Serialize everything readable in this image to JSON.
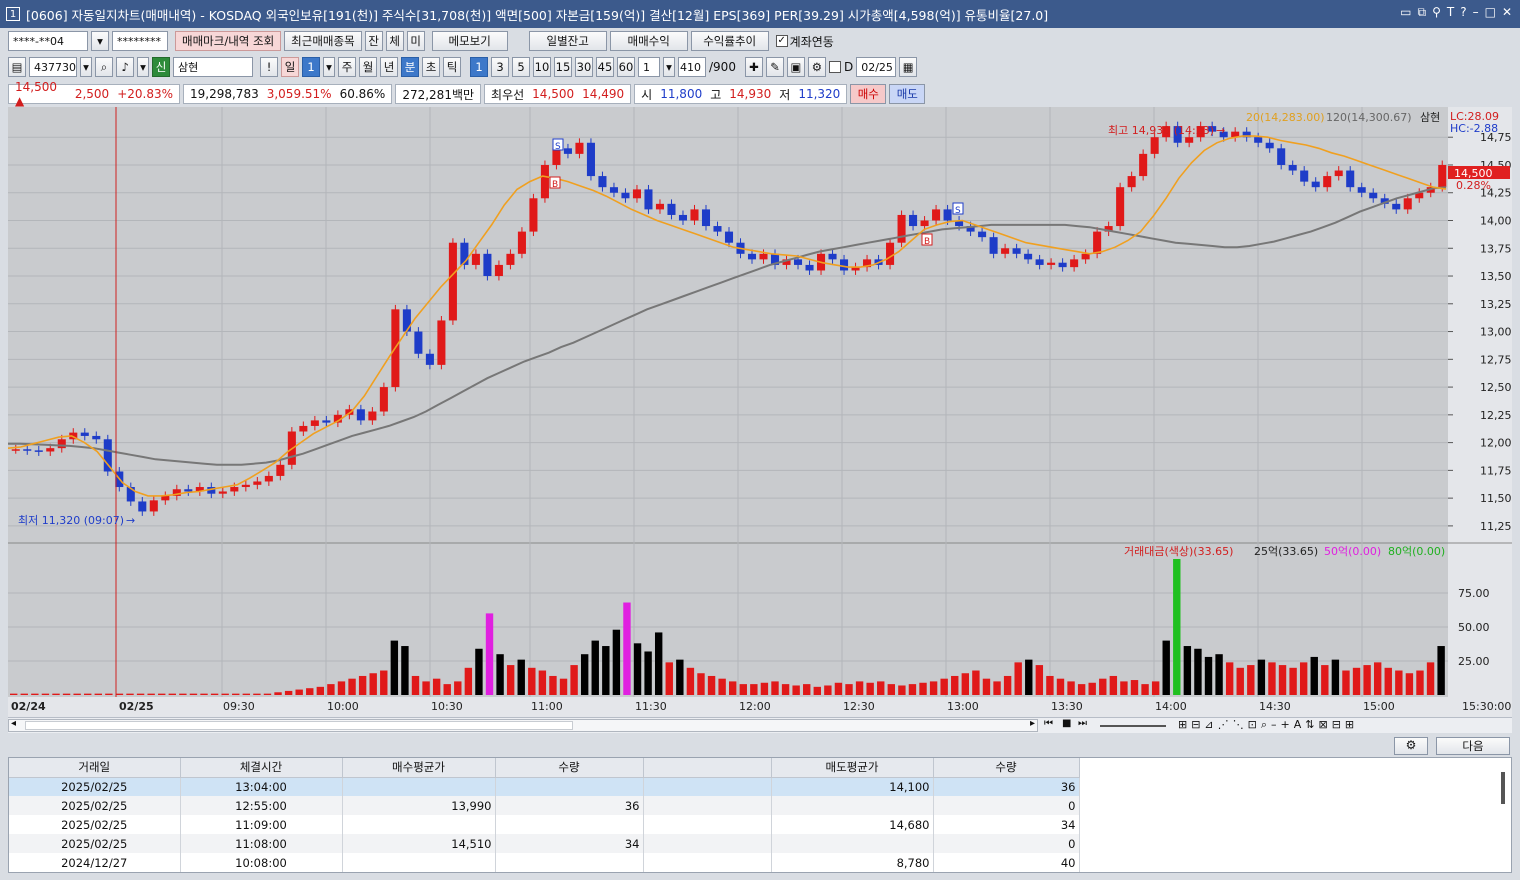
{
  "window": {
    "icon": "1",
    "title": "[0606] 자동일지차트(매매내역) - KOSDAQ 외국인보유[191(천)] 주식수[31,708(천)] 액면[500] 자본금[159(억)] 결산[12월] EPS[369] PER[39.29] 시가총액[4,598(억)] 유통비율[27.0]"
  },
  "toolbar1": {
    "account": "****-**04",
    "password": "********",
    "mark_btn": "매매마크/내역 조회",
    "recent_btn": "최근매매종목",
    "btn_jan": "잔",
    "btn_che": "체",
    "btn_mi": "미",
    "memo_btn": "메모보기",
    "daily_btn": "일별잔고",
    "profit_btn": "매매수익",
    "rate_btn": "수익률추이",
    "link_label": "계좌연동"
  },
  "toolbar2": {
    "code": "437730",
    "sin": "신",
    "name": "삼현",
    "periods": [
      "일",
      "1",
      "주",
      "월",
      "년",
      "분",
      "초",
      "틱"
    ],
    "minutes": [
      "1",
      "3",
      "5",
      "10",
      "15",
      "30",
      "45",
      "60"
    ],
    "interval": "1",
    "count": "410",
    "max": "/900",
    "d_label": "D",
    "date": "02/25"
  },
  "quote": {
    "price": "14,500",
    "change": "2,500",
    "rate": "+20.83%",
    "volume": "19,298,783",
    "vol_rate": "3,059.51%",
    "ratio": "60.86%",
    "amount": "272,281백만",
    "best_label": "최우선",
    "ask": "14,500",
    "bid": "14,490",
    "open_label": "시",
    "open": "11,800",
    "high_label": "고",
    "high": "14,930",
    "low_label": "저",
    "low": "11,320",
    "buy_btn": "매수",
    "sell_btn": "매도"
  },
  "chart_labels": {
    "ma20": "20(14,283.00)",
    "ma120": "120(14,300.67)",
    "name": "삼현",
    "lc": "LC:28.09",
    "hc": "HC:-2.88",
    "high_note": "최고 14,930 (14:23)",
    "low_note": "최저 11,320 (09:07)",
    "cur_price": "14,500",
    "cur_rate": "0.28%",
    "vol_title": "거래대금(색상)(33.65)",
    "vol_25": "25억(33.65)",
    "vol_50": "50억(0.00)",
    "vol_80": "80억(0.00)",
    "time_end": "15:30:00"
  },
  "chart_data": [
    {
      "type": "candlestick",
      "x_ticks": [
        "02/24",
        "02/25",
        "09:30",
        "10:00",
        "10:30",
        "11:00",
        "11:30",
        "12:00",
        "12:30",
        "13:00",
        "13:30",
        "14:00",
        "14:30",
        "15:00"
      ],
      "y_ticks": [
        14750,
        14500,
        14250,
        14000,
        13750,
        13500,
        13250,
        13000,
        12750,
        12500,
        12250,
        12000,
        11750,
        11500,
        11250
      ],
      "ylim": [
        11150,
        14950
      ],
      "series": [
        {
          "name": "20",
          "values": [
            11950,
            11960,
            11990,
            12020,
            12050,
            12060,
            12000,
            11920,
            11780,
            11640,
            11560,
            11520,
            11520,
            11530,
            11550,
            11560,
            11580,
            11600,
            11620,
            11680,
            11750,
            11820,
            11920,
            12000,
            12080,
            12140,
            12200,
            12280,
            12420,
            12600,
            12780,
            12950,
            13120,
            13260,
            13400,
            13520,
            13640,
            13800,
            13960,
            14140,
            14280,
            14350,
            14400,
            14380,
            14350,
            14310,
            14270,
            14220,
            14160,
            14100,
            14050,
            14000,
            13960,
            13920,
            13880,
            13840,
            13800,
            13760,
            13740,
            13720,
            13700,
            13690,
            13680,
            13650,
            13620,
            13600,
            13580,
            13580,
            13600,
            13650,
            13720,
            13820,
            13920,
            13960,
            13990,
            14000,
            13960,
            13920,
            13880,
            13840,
            13800,
            13780,
            13760,
            13740,
            13720,
            13700,
            13720,
            13760,
            13820,
            13900,
            14040,
            14200,
            14380,
            14520,
            14630,
            14700,
            14740,
            14760,
            14760,
            14750,
            14720,
            14700,
            14680,
            14650,
            14610,
            14580,
            14540,
            14500,
            14460,
            14420,
            14380,
            14340,
            14300,
            14283
          ]
        },
        {
          "name": "120",
          "values": [
            11990,
            11990,
            11985,
            11980,
            11975,
            11970,
            11960,
            11950,
            11930,
            11910,
            11890,
            11870,
            11850,
            11840,
            11830,
            11820,
            11810,
            11800,
            11800,
            11800,
            11810,
            11820,
            11840,
            11870,
            11900,
            11940,
            11980,
            12020,
            12060,
            12090,
            12120,
            12150,
            12190,
            12230,
            12280,
            12340,
            12400,
            12460,
            12520,
            12580,
            12630,
            12680,
            12730,
            12770,
            12810,
            12860,
            12900,
            12950,
            13000,
            13050,
            13100,
            13150,
            13200,
            13240,
            13280,
            13320,
            13360,
            13400,
            13440,
            13480,
            13520,
            13560,
            13600,
            13630,
            13660,
            13690,
            13720,
            13740,
            13760,
            13780,
            13800,
            13820,
            13840,
            13860,
            13880,
            13900,
            13920,
            13930,
            13940,
            13950,
            13960,
            13960,
            13960,
            13960,
            13960,
            13960,
            13960,
            13950,
            13940,
            13920,
            13900,
            13880,
            13860,
            13840,
            13820,
            13800,
            13790,
            13780,
            13770,
            13760,
            13760,
            13770,
            13790,
            13810,
            13840,
            13870,
            13900,
            13940,
            13980,
            14030,
            14080,
            14120,
            14160,
            14200,
            14230,
            14260,
            14290,
            14300
          ]
        }
      ],
      "candles": [
        11940,
        11930,
        11920,
        11950,
        12030,
        12090,
        12060,
        12030,
        11740,
        11600,
        11470,
        11380,
        11480,
        11520,
        11580,
        11560,
        11600,
        11540,
        11560,
        11600,
        11620,
        11650,
        11700,
        11800,
        12100,
        12150,
        12200,
        12180,
        12250,
        12300,
        12200,
        12280,
        12500,
        13200,
        13000,
        12800,
        12700,
        13100,
        13800,
        13600,
        13700,
        13500,
        13600,
        13700,
        13900,
        14200,
        14500,
        14650,
        14600,
        14700,
        14400,
        14300,
        14250,
        14200,
        14280,
        14100,
        14150,
        14050,
        14000,
        14100,
        13950,
        13900,
        13800,
        13700,
        13650,
        13700,
        13600,
        13650,
        13600,
        13550,
        13700,
        13650,
        13550,
        13580,
        13650,
        13600,
        13800,
        14050,
        13950,
        14000,
        14100,
        14000,
        13950,
        13900,
        13850,
        13700,
        13750,
        13700,
        13650,
        13600,
        13620,
        13580,
        13650,
        13700,
        13900,
        13950,
        14300,
        14400,
        14600,
        14750,
        14850,
        14700,
        14750,
        14850,
        14800,
        14750,
        14800,
        14750,
        14700,
        14650,
        14500,
        14450,
        14350,
        14300,
        14400,
        14450,
        14300,
        14250,
        14200,
        14150,
        14100,
        14200,
        14250,
        14300,
        14500
      ],
      "annotations": [
        "최고 14,930 (14:23)",
        "최저 11,320 (09:07)"
      ]
    },
    {
      "type": "bar",
      "title": "거래대금(색상)(33.65)",
      "y_ticks": [
        75,
        50,
        25
      ],
      "ylim": [
        0,
        100
      ],
      "values": [
        1,
        1,
        1,
        1,
        1,
        1,
        1,
        1,
        1,
        1,
        1,
        1,
        1,
        1,
        1,
        1,
        1,
        1,
        1,
        1,
        1,
        1,
        1,
        1,
        1,
        2,
        3,
        4,
        5,
        6,
        8,
        10,
        12,
        14,
        16,
        18,
        40,
        36,
        14,
        10,
        12,
        8,
        10,
        20,
        34,
        60,
        30,
        22,
        26,
        20,
        18,
        14,
        12,
        22,
        30,
        40,
        36,
        48,
        68,
        38,
        32,
        46,
        24,
        26,
        20,
        16,
        14,
        12,
        10,
        8,
        8,
        9,
        10,
        8,
        7,
        8,
        6,
        7,
        9,
        8,
        10,
        9,
        10,
        8,
        7,
        8,
        9,
        10,
        12,
        14,
        16,
        18,
        12,
        10,
        14,
        24,
        26,
        22,
        14,
        12,
        10,
        8,
        9,
        12,
        14,
        10,
        11,
        8,
        10,
        40,
        100,
        36,
        34,
        28,
        30,
        24,
        20,
        22,
        26,
        24,
        22,
        20,
        24,
        28,
        22,
        26,
        18,
        20,
        22,
        24,
        20,
        18,
        16,
        18,
        24,
        36
      ]
    }
  ],
  "bottom": {
    "next_btn": "다음",
    "headers": [
      "거래일",
      "체결시간",
      "매수평균가",
      "수량",
      "",
      "매도평균가",
      "수량"
    ],
    "rows": [
      [
        "2025/02/25",
        "13:04:00",
        "",
        "",
        "",
        "14,100",
        "36"
      ],
      [
        "2025/02/25",
        "12:55:00",
        "13,990",
        "36",
        "",
        "",
        "0"
      ],
      [
        "2025/02/25",
        "11:09:00",
        "",
        "",
        "",
        "14,680",
        "34"
      ],
      [
        "2025/02/25",
        "11:08:00",
        "14,510",
        "34",
        "",
        "",
        "0"
      ],
      [
        "2024/12/27",
        "10:08:00",
        "",
        "",
        "",
        "8,780",
        "40"
      ]
    ]
  },
  "colors": {
    "title_bg": "#3c5a8c",
    "up": "#e01919",
    "down": "#1e3cc8",
    "ma20": "#f0a020",
    "ma120": "#777777",
    "chart_bg": "#c9cbce"
  }
}
